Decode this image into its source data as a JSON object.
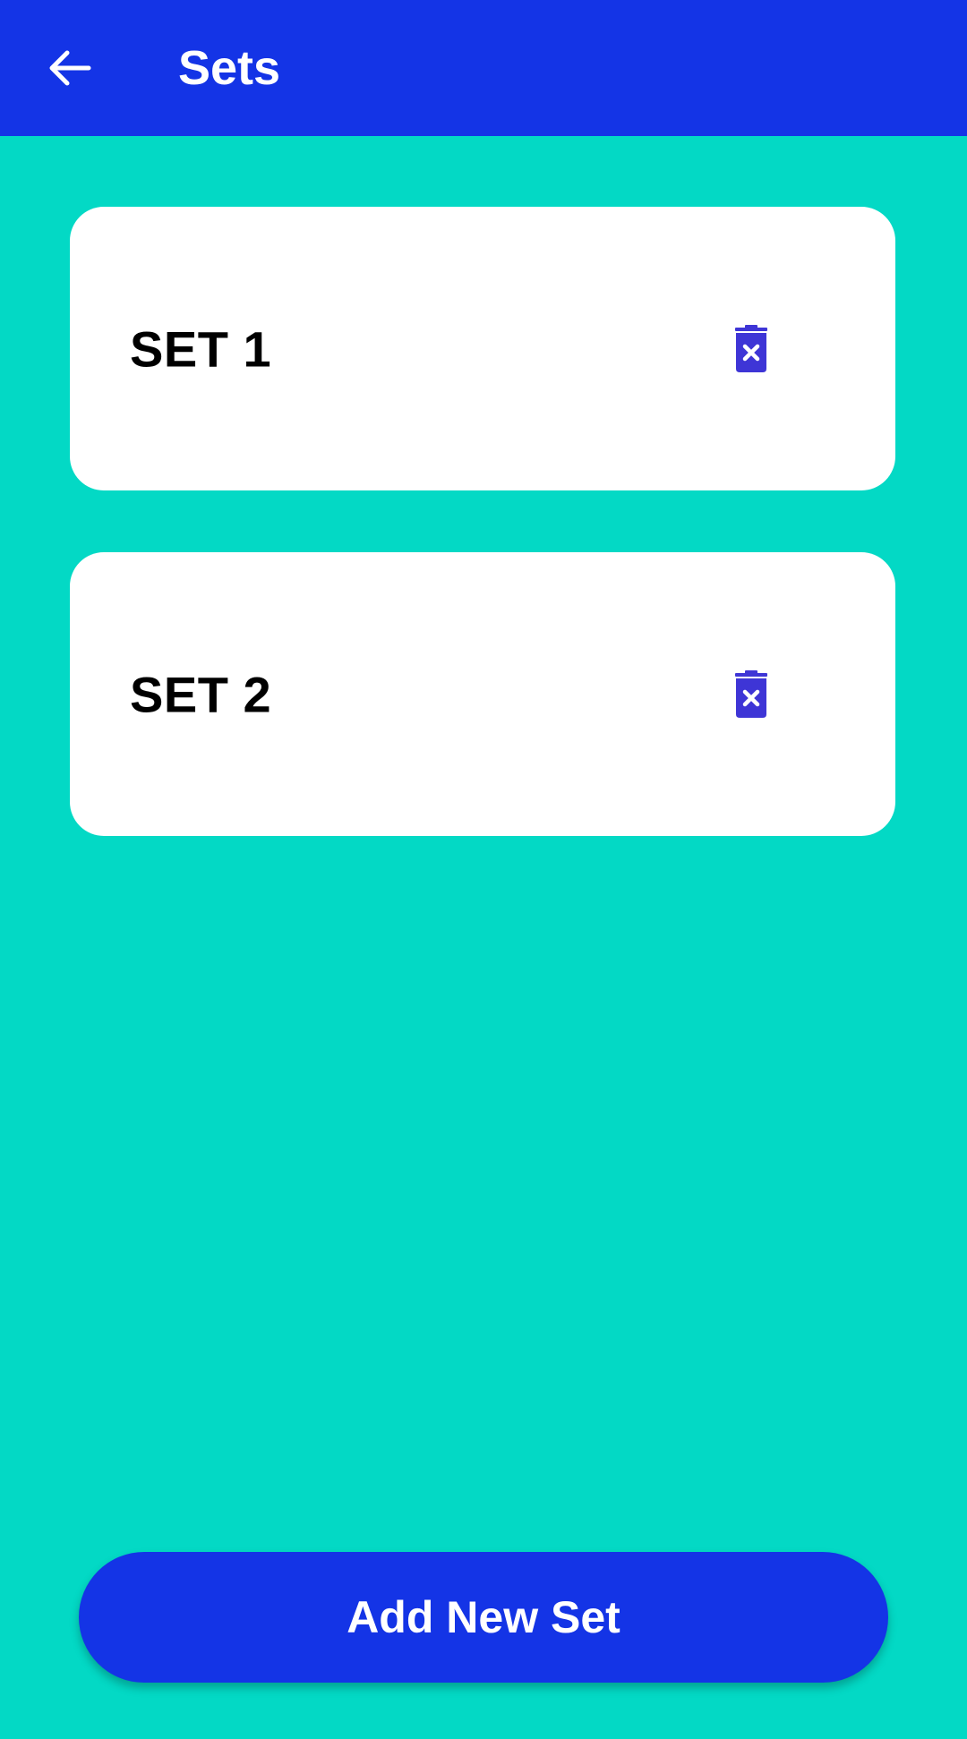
{
  "app_bar": {
    "title": "Sets",
    "back_icon": "arrow-left-icon"
  },
  "sets": [
    {
      "label": "SET 1",
      "delete_icon": "trash-x-icon"
    },
    {
      "label": "SET 2",
      "delete_icon": "trash-x-icon"
    }
  ],
  "add_button": {
    "label": "Add New Set"
  },
  "colors": {
    "primary": "#1434E6",
    "background": "#03D9C5",
    "card": "#ffffff",
    "icon_accent": "#3E35D6"
  }
}
